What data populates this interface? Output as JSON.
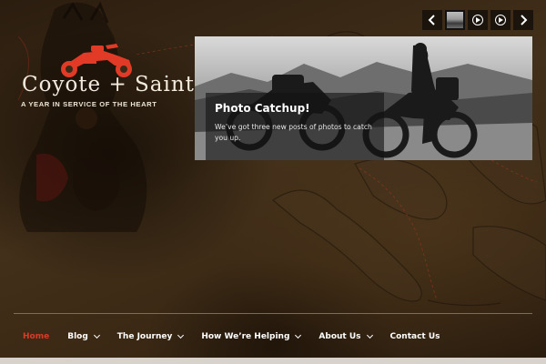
{
  "logo": {
    "title": "Coyote + Saint",
    "tagline": "A YEAR IN SERVICE OF THE HEART",
    "icon": "motorcycle-icon"
  },
  "slider": {
    "controls": {
      "prev_icon": "chevron-left-icon",
      "thumb": "slide-thumbnail",
      "play1_icon": "play-circle-icon",
      "play2_icon": "play-circle-icon",
      "next_icon": "chevron-right-icon"
    },
    "slide": {
      "title": "Photo Catchup!",
      "text": "We’ve got three new posts of photos to catch you up."
    }
  },
  "nav": {
    "items": [
      {
        "label": "Home",
        "active": true,
        "dropdown": false
      },
      {
        "label": "Blog",
        "active": false,
        "dropdown": true
      },
      {
        "label": "The Journey",
        "active": false,
        "dropdown": true
      },
      {
        "label": "How We’re Helping",
        "active": false,
        "dropdown": true
      },
      {
        "label": "About Us",
        "active": false,
        "dropdown": true
      },
      {
        "label": "Contact Us",
        "active": false,
        "dropdown": false
      }
    ]
  },
  "colors": {
    "accent_red": "#d93b28",
    "background_brown": "#3a2a17",
    "nav_text": "#ffffff"
  }
}
